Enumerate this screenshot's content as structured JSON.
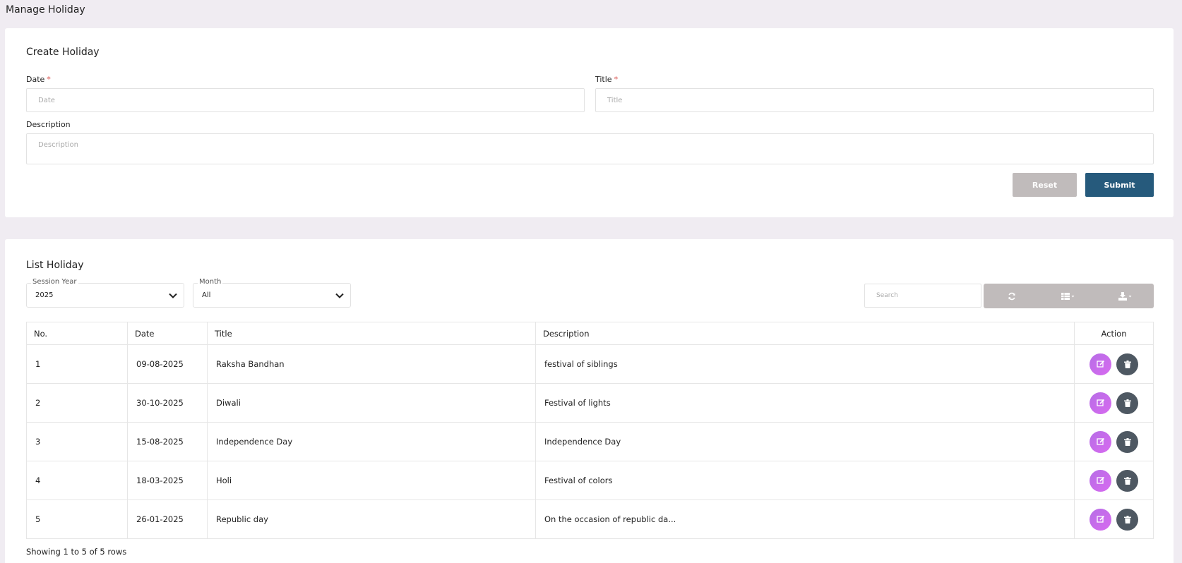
{
  "page": {
    "title": "Manage Holiday"
  },
  "create": {
    "title": "Create Holiday",
    "date_label": "Date",
    "date_placeholder": "Date",
    "title_label": "Title",
    "title_placeholder": "Title",
    "required_mark": "*",
    "description_label": "Description",
    "description_placeholder": "Description",
    "reset_label": "Reset",
    "submit_label": "Submit"
  },
  "list": {
    "title": "List Holiday",
    "session_year": {
      "legend": "Session Year",
      "value": "2025"
    },
    "month": {
      "legend": "Month",
      "value": "All"
    },
    "search_placeholder": "Search",
    "toolbar_icons": [
      "refresh-icon",
      "columns-icon",
      "export-icon"
    ],
    "columns": [
      "No.",
      "Date",
      "Title",
      "Description",
      "Action"
    ],
    "rows": [
      {
        "no": "1",
        "date": "09-08-2025",
        "title": "Raksha Bandhan",
        "description": "festival of siblings"
      },
      {
        "no": "2",
        "date": "30-10-2025",
        "title": "Diwali",
        "description": "Festival of lights"
      },
      {
        "no": "3",
        "date": "15-08-2025",
        "title": "Independence Day",
        "description": "Independence Day"
      },
      {
        "no": "4",
        "date": "18-03-2025",
        "title": "Holi",
        "description": "Festival of colors"
      },
      {
        "no": "5",
        "date": "26-01-2025",
        "title": "Republic day",
        "description": "On the occasion of republic da..."
      }
    ],
    "footer": "Showing 1 to 5 of 5 rows"
  },
  "colors": {
    "background": "#f0ecf2",
    "submit": "#265a7c",
    "reset": "#c0bbbb",
    "edit": "#c86cec",
    "delete": "#4e5862",
    "required": "#d9534f"
  }
}
